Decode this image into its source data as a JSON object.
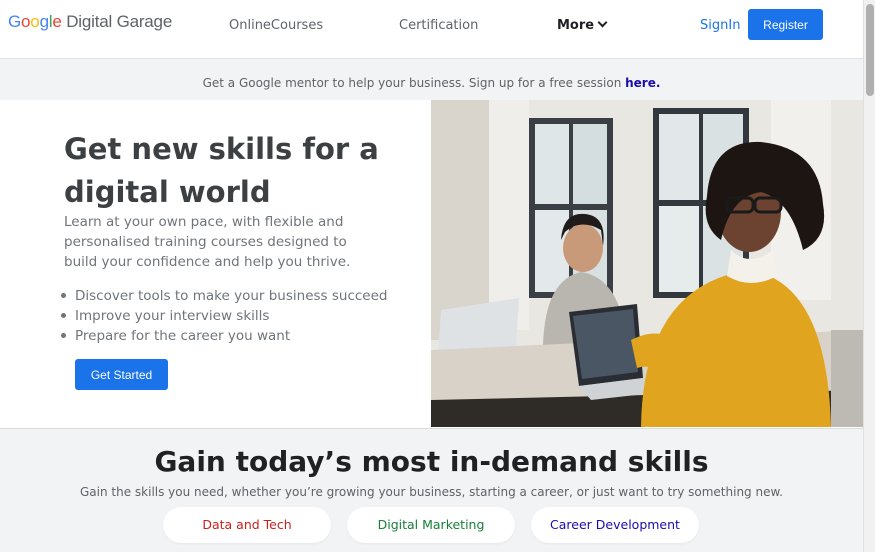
{
  "header": {
    "logo_google": [
      "G",
      "o",
      "o",
      "g",
      "l",
      "e"
    ],
    "logo_product": "Digital Garage",
    "nav": {
      "online_courses": "OnlineCourses",
      "certification": "Certification",
      "more": "More"
    },
    "signin": "SignIn",
    "register": "Register"
  },
  "banner": {
    "text": "Get a Google mentor to help your business. Sign up for a free session ",
    "link": "here."
  },
  "hero": {
    "title": "Get new skills for a digital world",
    "description": "Learn at your own pace, with flexible and personalised training courses designed to build your confidence and help you thrive.",
    "bullets": [
      "Discover tools to make your business succeed",
      "Improve your interview skills",
      "Prepare for the career you want"
    ],
    "cta": "Get Started"
  },
  "skills": {
    "title": "Gain today’s most in-demand skills",
    "subtitle": "Gain the skills you need, whether you’re growing your business, starting a career, or just want to try something new.",
    "pills": [
      "Data and Tech",
      "Digital Marketing",
      "Career Development"
    ]
  },
  "colors": {
    "accent": "#1a73e8",
    "data_tech": "#c5221f",
    "digital_marketing": "#188038",
    "career_development": "#1a0dab"
  },
  "icons": {
    "more_menu": "chevron-down-icon"
  }
}
